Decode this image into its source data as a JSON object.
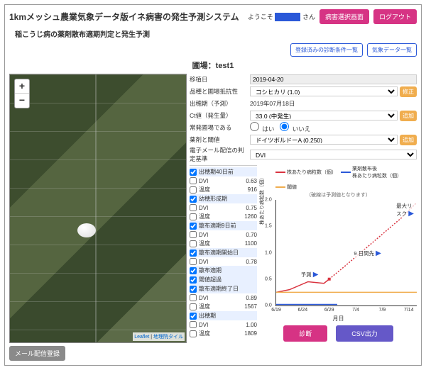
{
  "header": {
    "title": "1kmメッシュ農業気象データ版イネ病害の発生予測システム",
    "welcome_prefix": "ようこそ",
    "welcome_suffix": "さん",
    "select_screen": "病害選択画面",
    "logout": "ログアウト"
  },
  "subtitle": "稲こうじ病の薬剤散布適期判定と発生予測",
  "top_links": {
    "saved": "登録済みの診断条件一覧",
    "weather": "気象データ一覧"
  },
  "field_label": "圃場：",
  "field_name": "test1",
  "form": {
    "transplant": {
      "label": "移植日",
      "value": "2019-04-20"
    },
    "variety": {
      "label": "品種と圃場抵抗性",
      "value": "コシヒカリ (1.0)",
      "btn": "修正"
    },
    "heading": {
      "label": "出穂期（予測）",
      "value": "2019年07月18日"
    },
    "ct": {
      "label": "Ct値（発生量）",
      "value": "33.0 (中発生)",
      "btn": "追加"
    },
    "regular": {
      "label": "常発圃場である",
      "yes": "はい",
      "no": "いいえ",
      "sel": "no"
    },
    "chemical": {
      "label": "薬剤と閾値",
      "value": "ドイツボルドーA (0.250)",
      "btn": "追加"
    },
    "mail": {
      "label": "電子メール配信の判定基準",
      "value": "DVI"
    }
  },
  "map": {
    "zoom_in": "+",
    "zoom_out": "−",
    "leaflet": "Leaflet",
    "tiles": "地理院タイル",
    "mail_btn": "メール配信登録"
  },
  "checks": [
    {
      "on": true,
      "label": "出穂期40日前"
    },
    {
      "on": false,
      "label": "DVI",
      "val": "0.63"
    },
    {
      "on": false,
      "label": "温度",
      "val": "916"
    },
    {
      "on": true,
      "label": "幼穂形成期"
    },
    {
      "on": false,
      "label": "DVI",
      "val": "0.75"
    },
    {
      "on": false,
      "label": "温度",
      "val": "1260"
    },
    {
      "on": true,
      "label": "散布適期9日前"
    },
    {
      "on": false,
      "label": "DVI",
      "val": "0.70"
    },
    {
      "on": false,
      "label": "温度",
      "val": "1100"
    },
    {
      "on": true,
      "label": "散布適期開始日"
    },
    {
      "on": false,
      "label": "DVI",
      "val": "0.78"
    },
    {
      "on": true,
      "label": "散布適期"
    },
    {
      "on": true,
      "label": "閾値超過"
    },
    {
      "on": true,
      "label": "散布適期終了日"
    },
    {
      "on": false,
      "label": "DVI",
      "val": "0.89"
    },
    {
      "on": false,
      "label": "温度",
      "val": "1567"
    },
    {
      "on": true,
      "label": "出穂期"
    },
    {
      "on": false,
      "label": "DVI",
      "val": "1.00"
    },
    {
      "on": false,
      "label": "温度",
      "val": "1809"
    }
  ],
  "chart_data": {
    "type": "line",
    "title": "",
    "xlabel": "月日",
    "ylabel": "株あたり病粒数（個）",
    "ylim": [
      0,
      2.0
    ],
    "yticks": [
      0,
      0.5,
      1.0,
      1.5,
      2.0
    ],
    "categories": [
      "6/19",
      "6/24",
      "6/29",
      "7/4",
      "7/9",
      "7/14"
    ],
    "series": [
      {
        "name": "株あたり病粒数（個）",
        "color": "#d9333f",
        "solid": true,
        "x": [
          0,
          0.5,
          1.2,
          1.8,
          2.0
        ],
        "y": [
          0.25,
          0.3,
          0.45,
          0.42,
          0.5
        ]
      },
      {
        "name": "予測",
        "color": "#d9333f",
        "dashed": true,
        "x": [
          2.0,
          2.6,
          3.3,
          4.0,
          4.7,
          5.3
        ],
        "y": [
          0.5,
          0.75,
          1.05,
          1.35,
          1.65,
          1.95
        ]
      },
      {
        "name": "薬剤散布後 株あたり病粒数（個）",
        "color": "#2a58d8",
        "solid": true,
        "x": [
          0,
          1,
          2,
          2.3
        ],
        "y": [
          0.02,
          0.02,
          0.02,
          0.02
        ]
      },
      {
        "name": "閾値",
        "color": "#f0ad4e",
        "solid": true,
        "x": [
          0,
          5.3
        ],
        "y": [
          0.25,
          0.25
        ]
      }
    ],
    "note": "（破線は予測値となります）",
    "annotations": [
      {
        "text": "予測",
        "x": 0.9,
        "y": 0.55
      },
      {
        "text": "9 日間先",
        "x": 2.9,
        "y": 0.95
      },
      {
        "text": "最大リスク",
        "x": 4.5,
        "y": 1.85
      }
    ]
  },
  "legend": {
    "l1": "株あたり病粒数（個）",
    "l2": "薬剤散布後\n株あたり病粒数（個）",
    "l3": "閾値"
  },
  "actions": {
    "diagnose": "診断",
    "csv": "CSV出力"
  }
}
